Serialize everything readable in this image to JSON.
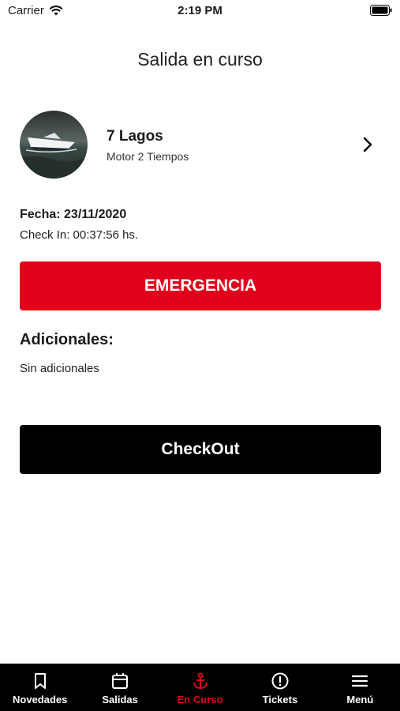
{
  "status_bar": {
    "carrier": "Carrier",
    "time": "2:19 PM"
  },
  "header": {
    "title": "Salida en curso"
  },
  "boat": {
    "name": "7 Lagos",
    "engine": "Motor 2 Tiempos"
  },
  "trip": {
    "fecha": "Fecha: 23/11/2020",
    "checkin": "Check In: 00:37:56 hs."
  },
  "actions": {
    "emergency_label": "EMERGENCIA",
    "checkout_label": "CheckOut"
  },
  "additionals": {
    "title": "Adicionales:",
    "text": "Sin adicionales"
  },
  "tabs": [
    {
      "label": "Novedades",
      "icon": "bookmark-icon",
      "active": false
    },
    {
      "label": "Salidas",
      "icon": "calendar-icon",
      "active": false
    },
    {
      "label": "En Curso",
      "icon": "anchor-icon",
      "active": true
    },
    {
      "label": "Tickets",
      "icon": "alert-circle-icon",
      "active": false
    },
    {
      "label": "Menú",
      "icon": "menu-icon",
      "active": false
    }
  ],
  "colors": {
    "accent": "#e0001b",
    "checkout": "#000000",
    "tab_bar": "#000000"
  }
}
